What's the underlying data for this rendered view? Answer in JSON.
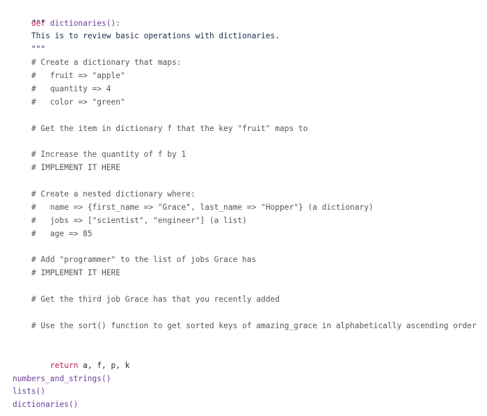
{
  "editor": {
    "lines": {
      "def_keyword": "def",
      "def_name": "dictionaries():",
      "docstring_open": "\"\"\"",
      "docstring_text": "This is to review basic operations with dictionaries.",
      "docstring_close": "\"\"\"",
      "c1": "# Create a dictionary that maps:",
      "c2": "#   fruit => \"apple\"",
      "c3": "#   quantity => 4",
      "c4": "#   color => \"green\"",
      "c5": "# Get the item in dictionary f that the key \"fruit\" maps to",
      "c6": "# Increase the quantity of f by 1",
      "c7": "# IMPLEMENT IT HERE",
      "c8": "# Create a nested dictionary where:",
      "c9": "#   name => {first_name => \"Grace\", last_name => \"Hopper\"} (a dictionary)",
      "c10": "#   jobs => [\"scientist\", \"engineer\"] (a list)",
      "c11": "#   age => 85",
      "c12": "# Add \"programmer\" to the list of jobs Grace has",
      "c13": "# IMPLEMENT IT HERE",
      "c14": "# Get the third job Grace has that you recently added",
      "c15": "# Use the sort() function to get sorted keys of amazing_grace in alphabetically ascending order",
      "return_keyword": "return",
      "return_values": " a, f, p, k",
      "call1": "numbers_and_strings()",
      "call2": "lists()",
      "call3": "dictionaries()"
    }
  }
}
